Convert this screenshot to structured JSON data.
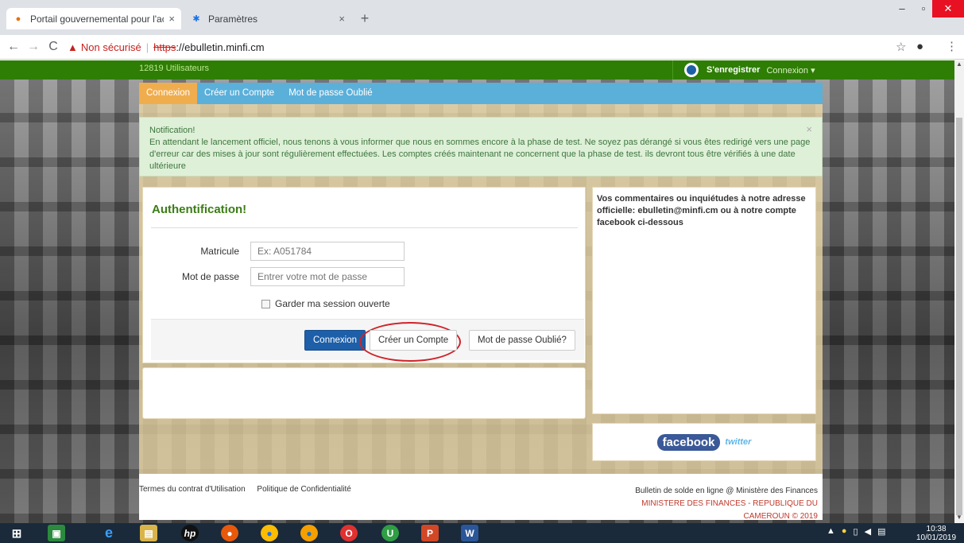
{
  "browser": {
    "tabs": [
      {
        "label": "Portail gouvernemental pour l'ac",
        "close": "×"
      },
      {
        "label": "Paramètres",
        "close": "×"
      }
    ],
    "new_tab": "+",
    "window": {
      "minimize": "–",
      "maximize": "▫",
      "close": "✕"
    },
    "nav": {
      "back": "←",
      "forward": "→",
      "reload": "C"
    },
    "address": {
      "warning_icon": "▲",
      "security_label": "Non sécurisé",
      "separator": "|",
      "protocol": "https",
      "host": "://ebulletin.minfi.cm"
    },
    "star": "☆",
    "account": "●",
    "menu": "⋮"
  },
  "topbar": {
    "user_count": "12819 Utilisateurs",
    "register_label": "S'enregistrer",
    "login_label": "Connexion",
    "login_caret": "▾"
  },
  "tabs_nav": [
    {
      "label": "Connexion"
    },
    {
      "label": "Créer un Compte"
    },
    {
      "label": "Mot de passe Oublié"
    }
  ],
  "notification": {
    "title": "Notification!",
    "body": "En attendant le lancement officiel, nous tenons à vous informer que nous en sommes encore à la phase de test. Ne soyez pas dérangé si vous êtes redirigé vers une page d'erreur car des mises à jour sont régulièrement effectuées. Les comptes créés maintenant ne concernent que la phase de test. ils devront tous être vérifiés à une date ultérieure",
    "close": "×"
  },
  "auth": {
    "title": "Authentification!",
    "matricule_label": "Matricule",
    "matricule_placeholder": "Ex: A051784",
    "password_label": "Mot de passe",
    "password_placeholder": "Entrer votre mot de passe",
    "remember_label": "Garder ma session ouverte",
    "buttons": {
      "login": "Connexion",
      "create": "Créer un Compte",
      "forgot": "Mot de passe Oublié?"
    }
  },
  "side": {
    "text": "Vos commentaires ou inquiétudes à notre adresse officielle: ebulletin@minfi.cm ou à notre compte facebook ci-dessous",
    "facebook": "facebook",
    "twitter": "twitter"
  },
  "footer": {
    "terms": "Termes du contrat d'Utilisation",
    "privacy": "Politique de Confidentialité",
    "right_line1": "Bulletin de solde en ligne @ Ministère des Finances",
    "right_line2": "MINISTERE DES FINANCES - REPUBLIQUE DU",
    "right_line3": "CAMEROUN © 2019"
  },
  "taskbar": {
    "time": "10:38",
    "date": "10/01/2019"
  },
  "colors": {
    "green_bar": "#2e7d05",
    "tabs_blue": "#5bb0da",
    "active_tab_orange": "#f0ad4e",
    "auth_title_green": "#3b7d16",
    "primary_button": "#1d5fa8",
    "highlight_circle": "#d0232a"
  }
}
